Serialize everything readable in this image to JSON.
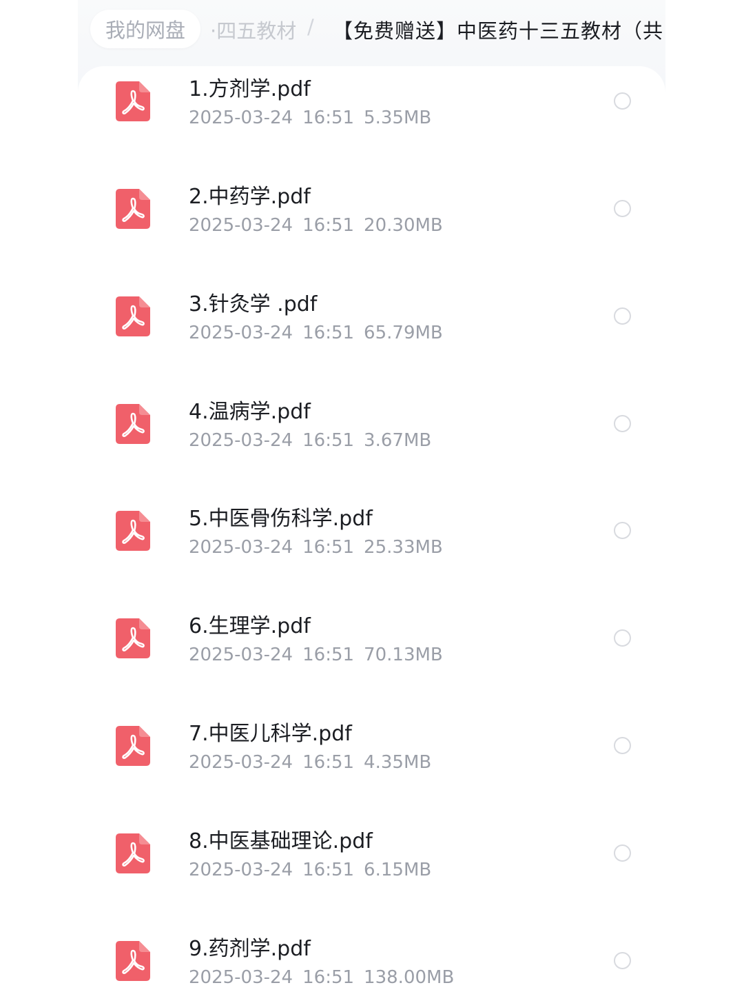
{
  "breadcrumb": {
    "home": "我的网盘",
    "middle": "·四五教材",
    "separator": "/",
    "current": "【免费赠送】中医药十三五教材（共"
  },
  "files": [
    {
      "name": "1.方剂学.pdf",
      "date": "2025-03-24",
      "time": "16:51",
      "size": "5.35MB",
      "icon": "pdf-icon",
      "selected": false
    },
    {
      "name": "2.中药学.pdf",
      "date": "2025-03-24",
      "time": "16:51",
      "size": "20.30MB",
      "icon": "pdf-icon",
      "selected": false
    },
    {
      "name": "3.针灸学 .pdf",
      "date": "2025-03-24",
      "time": "16:51",
      "size": "65.79MB",
      "icon": "pdf-icon",
      "selected": false
    },
    {
      "name": "4.温病学.pdf",
      "date": "2025-03-24",
      "time": "16:51",
      "size": "3.67MB",
      "icon": "pdf-icon",
      "selected": false
    },
    {
      "name": "5.中医骨伤科学.pdf",
      "date": "2025-03-24",
      "time": "16:51",
      "size": "25.33MB",
      "icon": "pdf-icon",
      "selected": false
    },
    {
      "name": "6.生理学.pdf",
      "date": "2025-03-24",
      "time": "16:51",
      "size": "70.13MB",
      "icon": "pdf-icon",
      "selected": false
    },
    {
      "name": "7.中医儿科学.pdf",
      "date": "2025-03-24",
      "time": "16:51",
      "size": "4.35MB",
      "icon": "pdf-icon",
      "selected": false
    },
    {
      "name": "8.中医基础理论.pdf",
      "date": "2025-03-24",
      "time": "16:51",
      "size": "6.15MB",
      "icon": "pdf-icon",
      "selected": false
    },
    {
      "name": "9.药剂学.pdf",
      "date": "2025-03-24",
      "time": "16:51",
      "size": "138.00MB",
      "icon": "pdf-icon",
      "selected": false
    }
  ],
  "colors": {
    "pdf_red": "#f0606a",
    "text_primary": "#1b1d22",
    "text_secondary": "#9a9ea7",
    "radio_border": "#d8dadf"
  }
}
